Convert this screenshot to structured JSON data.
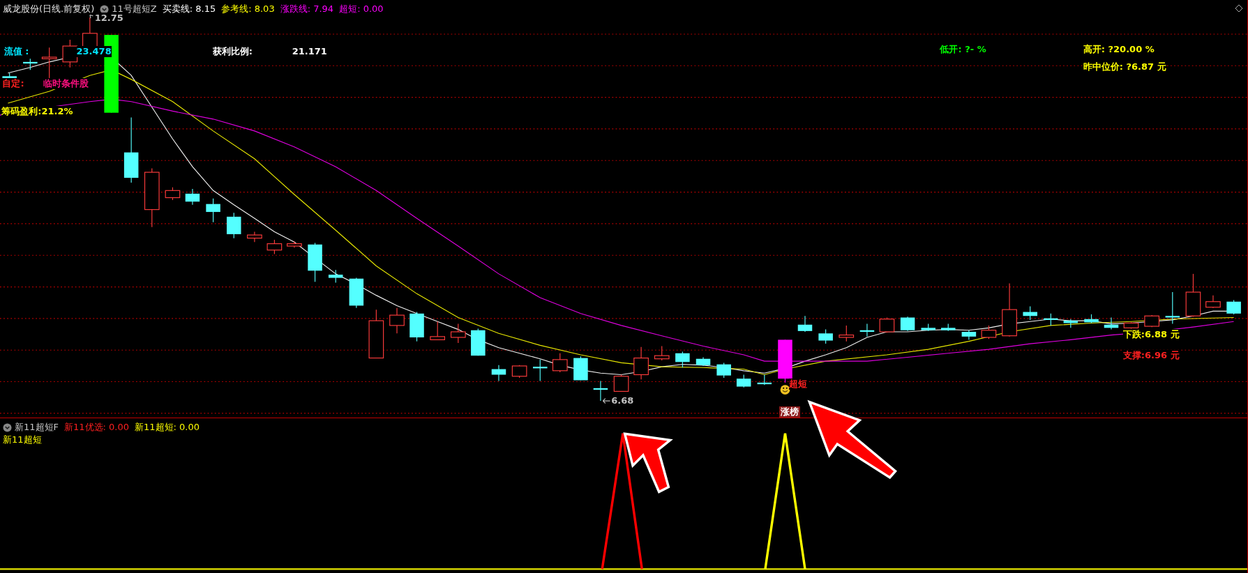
{
  "main_panel": {
    "title": "威龙股份(日线.前复权)",
    "indicator": "11号超短Z",
    "readings": [
      {
        "text": "买卖线: 8.15",
        "color": "#ffffff"
      },
      {
        "text": "参考线: 8.03",
        "color": "#ffff00"
      },
      {
        "text": "涨跌线: 7.94",
        "color": "#ff00ff"
      },
      {
        "text": "超短: 0.00",
        "color": "#ff00ff"
      }
    ],
    "labels": [
      {
        "kind": "text",
        "text": "12.75",
        "color": "#c0c0c0"
      },
      {
        "kind": "text",
        "text": "流值 :",
        "color": "#00e5ff"
      },
      {
        "kind": "text",
        "text": "23.478",
        "color": "#00e5ff"
      },
      {
        "kind": "text",
        "text": "获利比例:",
        "color": "#ffffff"
      },
      {
        "kind": "text",
        "text": "21.171",
        "color": "#ffffff"
      },
      {
        "kind": "text",
        "text": "自定:",
        "color": "#ff2020"
      },
      {
        "kind": "text",
        "text": "临时条件股",
        "color": "#ff1080"
      },
      {
        "kind": "text",
        "text": "筹码盈利:21.2%",
        "color": "#ffff00"
      },
      {
        "kind": "text",
        "text": "低开: ?- %",
        "color": "#00ff00"
      },
      {
        "kind": "text",
        "text": "高开: ?20.00 %",
        "color": "#ffff00"
      },
      {
        "kind": "text",
        "text": "昨中位价: ?6.87 元",
        "color": "#ffff00"
      },
      {
        "kind": "text",
        "text": "超短",
        "color": "#ff2020"
      },
      {
        "kind": "tag",
        "text": "涨榜",
        "color": "#8b1a1a"
      },
      {
        "kind": "text",
        "text": "6.68",
        "color": "#c0c0c0"
      },
      {
        "kind": "text",
        "text": "下跌:6.88 元",
        "color": "#ffff00"
      },
      {
        "kind": "text",
        "text": "支撑:6.96 元",
        "color": "#ff2020"
      }
    ]
  },
  "sub_panel": {
    "indicator": "新11超短F",
    "readings": [
      {
        "text": "新11优选: 0.00",
        "color": "#ff2020"
      },
      {
        "text": "新11超短: 0.00",
        "color": "#ffff00"
      }
    ],
    "legend": [
      {
        "text": "新11超短",
        "color": "#ffff00"
      }
    ]
  }
}
